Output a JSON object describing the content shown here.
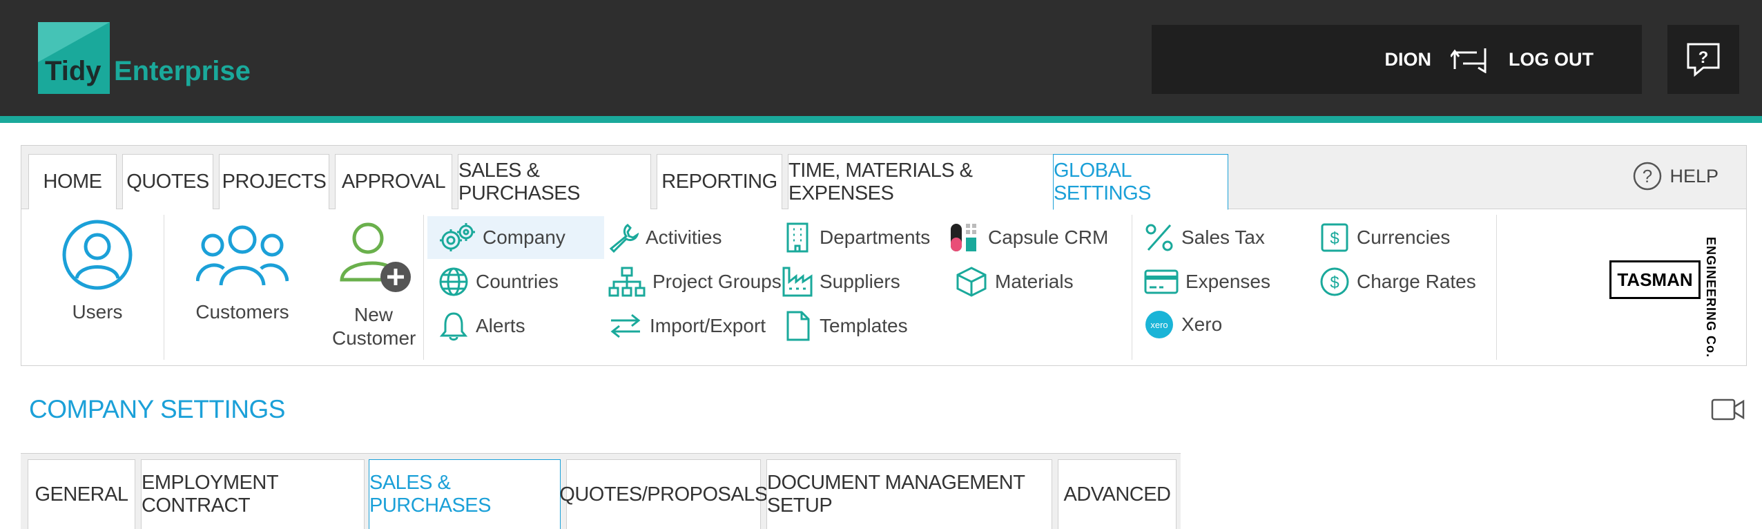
{
  "header": {
    "logo": {
      "tidy": "Tidy",
      "enterprise": "Enterprise"
    },
    "user_name": "DION",
    "logout_label": "LOG OUT",
    "help_icon": "help-chat-icon",
    "switch_icon": "switch-user-icon"
  },
  "nav": {
    "tabs": [
      {
        "label": "HOME"
      },
      {
        "label": "QUOTES"
      },
      {
        "label": "PROJECTS"
      },
      {
        "label": "APPROVAL"
      },
      {
        "label": "SALES & PURCHASES"
      },
      {
        "label": "REPORTING"
      },
      {
        "label": "TIME, MATERIALS & EXPENSES"
      },
      {
        "label": "GLOBAL SETTINGS",
        "active": true
      }
    ],
    "help_label": "HELP"
  },
  "global_settings": {
    "big_items": [
      {
        "label": "Users",
        "icon": "user-icon"
      },
      {
        "label": "Customers",
        "icon": "group-icon"
      },
      {
        "label": "New Customer",
        "icon": "add-user-icon"
      }
    ],
    "items": [
      {
        "label": "Company",
        "icon": "gears-icon"
      },
      {
        "label": "Countries",
        "icon": "globe-icon"
      },
      {
        "label": "Alerts",
        "icon": "bell-icon"
      },
      {
        "label": "Activities",
        "icon": "wrench-icon"
      },
      {
        "label": "Project Groups",
        "icon": "hierarchy-icon"
      },
      {
        "label": "Import/Export",
        "icon": "arrows-icon"
      },
      {
        "label": "Departments",
        "icon": "building-icon"
      },
      {
        "label": "Suppliers",
        "icon": "factory-icon"
      },
      {
        "label": "Templates",
        "icon": "document-icon"
      },
      {
        "label": "Capsule CRM",
        "icon": "capsule-icon"
      },
      {
        "label": "Materials",
        "icon": "box-icon"
      },
      {
        "label": "Sales Tax",
        "icon": "percent-icon"
      },
      {
        "label": "Expenses",
        "icon": "card-icon"
      },
      {
        "label": "Xero",
        "icon": "xero-icon"
      },
      {
        "label": "Currencies",
        "icon": "dollar-box-icon"
      },
      {
        "label": "Charge Rates",
        "icon": "dollar-circle-icon"
      }
    ],
    "brand": {
      "name": "TASMAN",
      "sub": "ENGINEERING Co."
    }
  },
  "page": {
    "title": "COMPANY SETTINGS",
    "video_icon": "video-icon",
    "subtabs": [
      {
        "label": "GENERAL"
      },
      {
        "label": "EMPLOYMENT CONTRACT"
      },
      {
        "label": "SALES & PURCHASES",
        "active": true
      },
      {
        "label": "QUOTES/PROPOSALS"
      },
      {
        "label": "DOCUMENT MANAGEMENT SETUP"
      },
      {
        "label": "ADVANCED"
      }
    ]
  },
  "colors": {
    "accent": "#1ba0d8",
    "teal": "#1aa99b",
    "green": "#6ab04c",
    "topbar": "#2e2e2e"
  }
}
